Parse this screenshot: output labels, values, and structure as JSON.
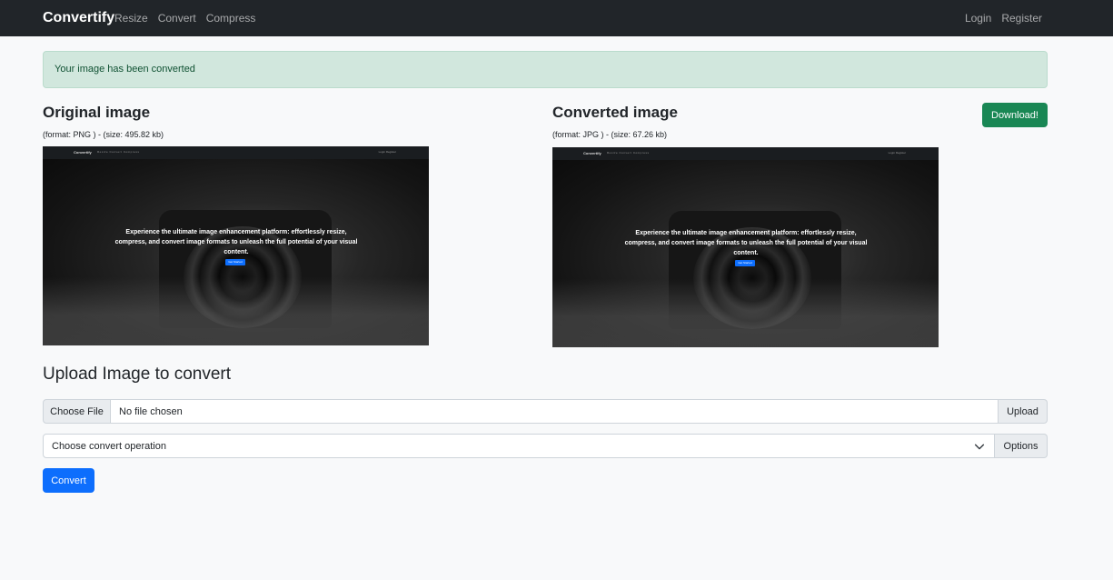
{
  "navbar": {
    "brand": "Convertify",
    "links": [
      "Resize",
      "Convert",
      "Compress"
    ],
    "right_links": [
      "Login",
      "Register"
    ]
  },
  "alert": {
    "message": "Your image has been converted",
    "color": "#d1e7dd"
  },
  "original": {
    "title": "Original image",
    "meta": "(format: PNG ) - (size: 495.82 kb)"
  },
  "converted": {
    "title": "Converted image",
    "meta": "(format: JPG ) - (size: 67.26 kb)",
    "download_label": "Download!"
  },
  "preview": {
    "brand": "Convertify",
    "links": "Resize Convert Compress",
    "right": "Login Register",
    "hero_text": "Experience the ultimate image enhancement platform: effortlessly resize, compress, and convert image formats to unleash the full potential of your visual content.",
    "hero_button": "Get Started"
  },
  "upload": {
    "title": "Upload Image to convert",
    "choose_file_label": "Choose File",
    "file_status": "No file chosen",
    "upload_label": "Upload",
    "select_value": "Choose convert operation",
    "options_label": "Options",
    "convert_label": "Convert"
  },
  "colors": {
    "navbar": "#212529",
    "success": "#198754",
    "primary": "#0d6efd"
  },
  "icons": {
    "select": "chevron-down-icon"
  }
}
